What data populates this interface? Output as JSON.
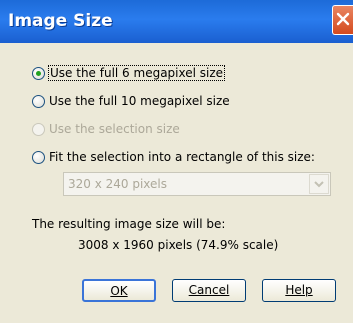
{
  "window": {
    "title": "Image Size",
    "close_icon": "close-icon"
  },
  "options": {
    "full_6mp": "Use the full 6 megapixel size",
    "full_10mp": "Use the full 10 megapixel size",
    "selection": "Use the selection size",
    "fit_rectangle": "Fit the selection into a rectangle of this size:"
  },
  "size_select": {
    "value": "320 x 240 pixels"
  },
  "result": {
    "label": "The resulting image size will be:",
    "value": "3008 x 1960 pixels (74.9% scale)"
  },
  "buttons": {
    "ok": "OK",
    "cancel": "Cancel",
    "help": "Help"
  },
  "colors": {
    "titlebar": "#2a7cee",
    "dialog_bg": "#ece9d8",
    "close_button": "#d44a1e",
    "radio_checked": "#21a121"
  }
}
